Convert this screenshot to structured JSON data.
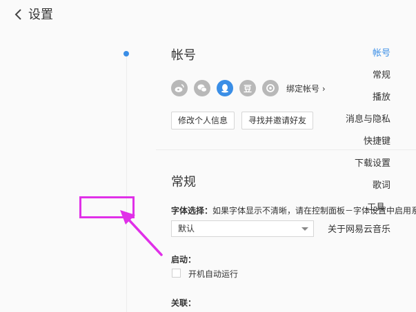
{
  "header": {
    "title": "设置"
  },
  "sidebar": {
    "items": [
      {
        "label": "帐号"
      },
      {
        "label": "常规"
      },
      {
        "label": "播放"
      },
      {
        "label": "消息与隐私"
      },
      {
        "label": "快捷键"
      },
      {
        "label": "下载设置"
      },
      {
        "label": "歌词"
      },
      {
        "label": "工具"
      },
      {
        "label": "关于网易云音乐"
      }
    ],
    "active_index": 0,
    "highlighted_index": 7
  },
  "account": {
    "title": "帐号",
    "social_icons": [
      "weibo-icon",
      "wechat-icon",
      "qq-icon",
      "douban-icon",
      "yixin-icon"
    ],
    "douban_glyph": "豆",
    "bind_label": "绑定帐号",
    "bind_arrow": "›",
    "edit_profile_label": "修改个人信息",
    "find_friends_label": "寻找并邀请好友"
  },
  "general": {
    "title": "常规",
    "font_label": "字体选择：",
    "font_hint": "如果字体显示不清晰，请在控制面板－字体设置中启用系统",
    "font_value": "默认",
    "startup_label": "启动：",
    "autostart_label": "开机自动运行",
    "autostart_checked": false,
    "association_label": "关联："
  },
  "colors": {
    "accent": "#3a8ee6",
    "highlight": "#e030e8"
  }
}
